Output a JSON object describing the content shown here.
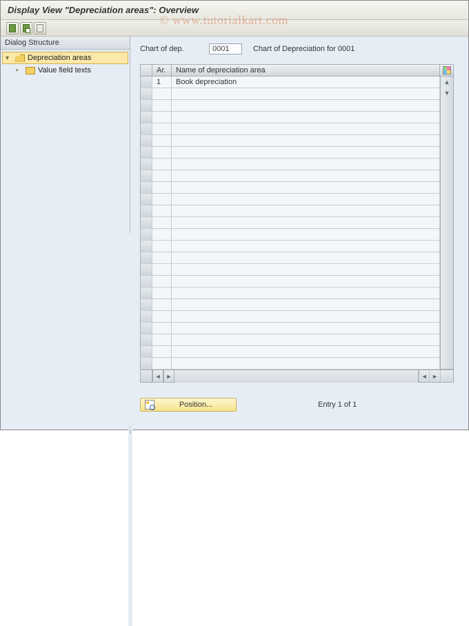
{
  "title": "Display View \"Depreciation areas\": Overview",
  "watermark": "© www.tutorialkart.com",
  "toolbar": {
    "btn1": "expand-all",
    "btn2": "collapse-all",
    "btn3": "copy"
  },
  "sidebar": {
    "header": "Dialog Structure",
    "items": [
      {
        "label": "Depreciation areas",
        "selected": true,
        "expanded": true
      },
      {
        "label": "Value field texts",
        "selected": false,
        "expanded": false
      }
    ]
  },
  "form": {
    "chart_label": "Chart of dep.",
    "chart_value": "0001",
    "chart_desc": "Chart of Depreciation for 0001"
  },
  "table": {
    "columns": {
      "ar": "Ar.",
      "name": "Name of depreciation area"
    },
    "rows": [
      {
        "ar": "1",
        "name": "Book depreciation"
      }
    ],
    "blank_rows": 24
  },
  "footer": {
    "position_label": "Position...",
    "entry_text": "Entry 1 of 1"
  }
}
